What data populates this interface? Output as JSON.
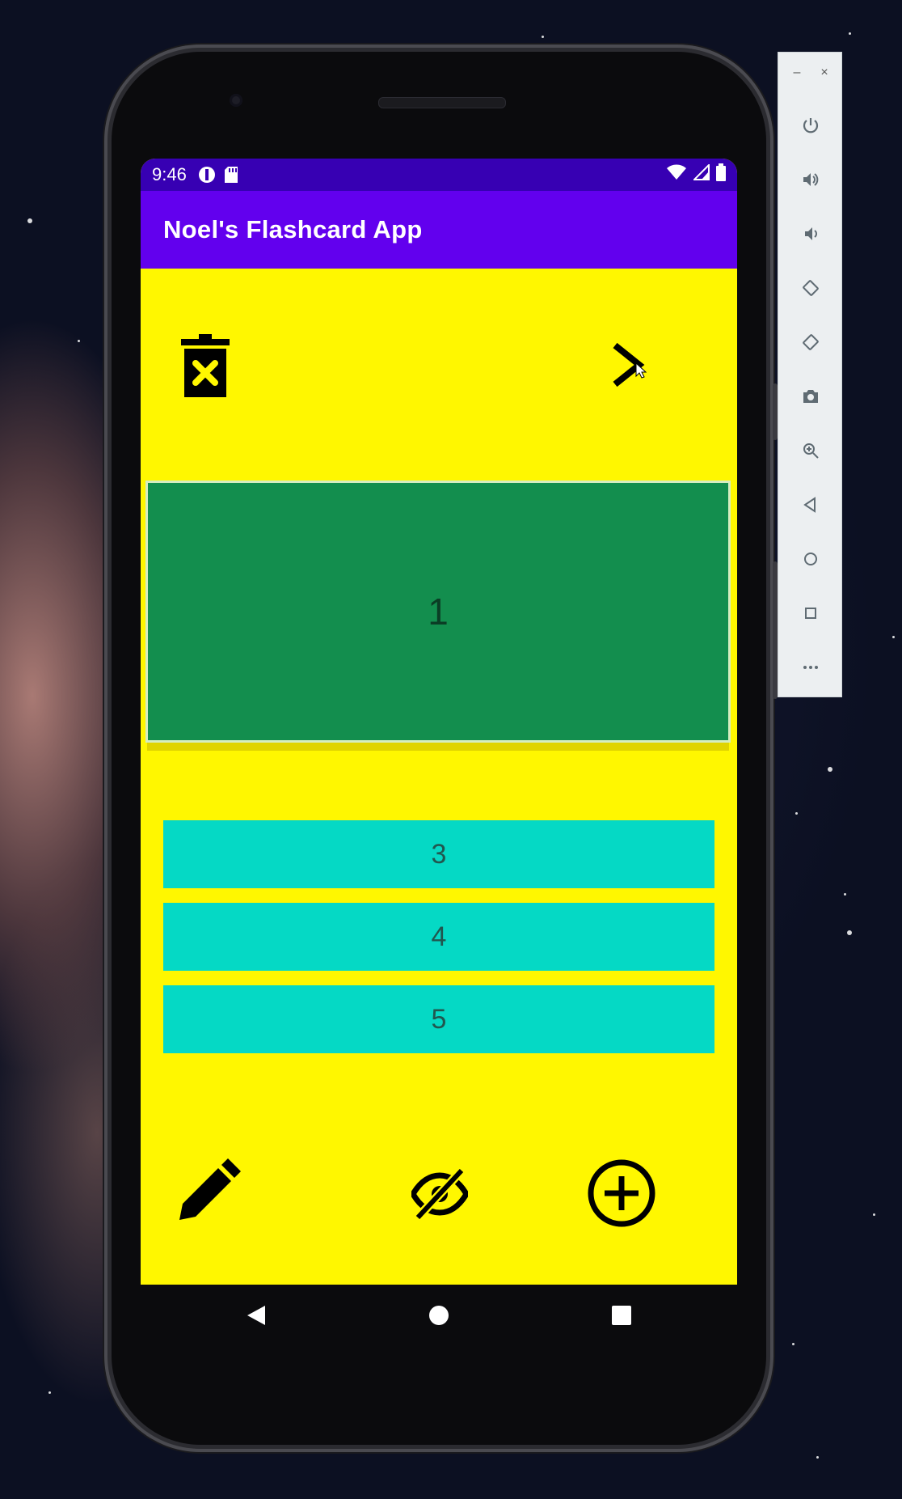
{
  "status_bar": {
    "time": "9:46",
    "left_icons": [
      "circle-badge-icon",
      "sd-card-icon"
    ],
    "right_icons": [
      "wifi-icon",
      "signal-icon",
      "battery-icon"
    ]
  },
  "app_bar": {
    "title": "Noel's Flashcard App"
  },
  "toolbar_top": {
    "delete_icon": "delete-forever-icon",
    "next_icon": "chevron-right-icon"
  },
  "card": {
    "text": "1"
  },
  "options": [
    {
      "label": "3"
    },
    {
      "label": "4"
    },
    {
      "label": "5"
    }
  ],
  "toolbar_bottom": {
    "edit_icon": "pencil-icon",
    "hide_icon": "eye-off-icon",
    "add_icon": "add-circle-icon"
  },
  "emulator_toolbar": {
    "window_buttons": [
      "–",
      "×"
    ],
    "tools": [
      "power-icon",
      "volume-up-icon",
      "volume-down-icon",
      "rotate-left-icon",
      "rotate-right-icon",
      "camera-icon",
      "zoom-icon",
      "back-icon",
      "home-icon",
      "overview-icon",
      "more-icon"
    ]
  },
  "colors": {
    "status_bar": "#3700b3",
    "app_bar": "#6200ee",
    "background": "#fff700",
    "card": "#138e4e",
    "option": "#05d9c5"
  }
}
